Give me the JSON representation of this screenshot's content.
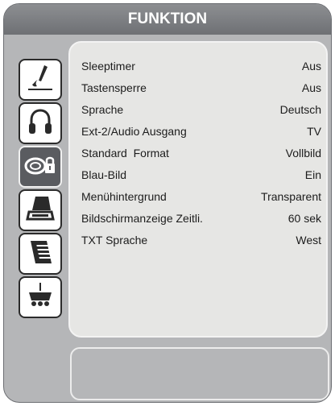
{
  "menu": {
    "title": "FUNKTION",
    "items": [
      {
        "label": "Sleeptimer",
        "value": "Aus"
      },
      {
        "label": "Tastensperre",
        "value": "Aus"
      },
      {
        "label": "Sprache",
        "value": "Deutsch"
      },
      {
        "label": "Ext-2/Audio Ausgang",
        "value": "TV"
      },
      {
        "label": "Standard  Format",
        "value": "Vollbild"
      },
      {
        "label": "Blau-Bild",
        "value": "Ein"
      },
      {
        "label": "Menühintergrund",
        "value": "Transparent"
      },
      {
        "label": "Bildschirmanzeige Zeitli.",
        "value": "60 sek"
      },
      {
        "label": "TXT Sprache",
        "value": "West"
      }
    ]
  },
  "sidebar": {
    "icons": [
      {
        "name": "picture-brush-icon",
        "active": false
      },
      {
        "name": "headphones-icon",
        "active": false
      },
      {
        "name": "function-lock-icon",
        "active": true
      },
      {
        "name": "antenna-install-icon",
        "active": false
      },
      {
        "name": "document-list-icon",
        "active": false
      },
      {
        "name": "scart-connector-icon",
        "active": false
      }
    ]
  },
  "colors": {
    "frame": "#b5b6b8",
    "titlebar": "#7b7d80",
    "panel": "#e6e6e4",
    "active_icon": "#5a5c60"
  }
}
